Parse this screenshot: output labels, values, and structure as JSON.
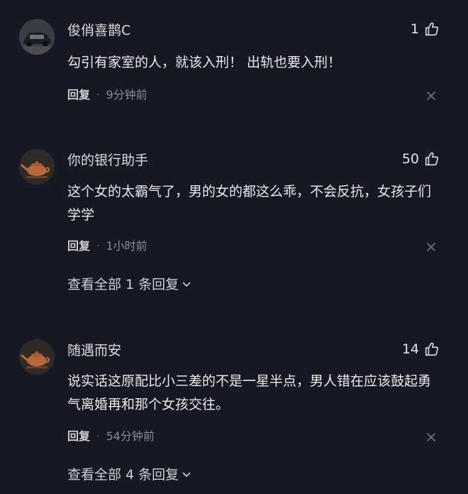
{
  "comments": [
    {
      "username": "俊俏喜鹊C",
      "likes": "1",
      "text": "勾引有家室的人，就该入刑！ 出轨也要入刑！",
      "reply_label": "回复",
      "separator": "·",
      "time": "9分钟前",
      "avatar_icon": "car-avatar"
    },
    {
      "username": "你的银行助手",
      "likes": "50",
      "text": "这个女的太霸气了，男的女的都这么乖，不会反抗，女孩子们学学",
      "reply_label": "回复",
      "separator": "·",
      "time": "1小时前",
      "view_all": "查看全部 1 条回复",
      "avatar_icon": "teapot-avatar"
    },
    {
      "username": "随遇而安",
      "likes": "14",
      "text": "说实话这原配比小三差的不是一星半点，男人错在应该鼓起勇气离婚再和那个女孩交往。",
      "reply_label": "回复",
      "separator": "·",
      "time": "54分钟前",
      "view_all": "查看全部 4 条回复",
      "avatar_icon": "teapot-avatar"
    }
  ],
  "colors": {
    "background": "#161823",
    "text": "#eaeaec",
    "muted": "#8a8b93"
  }
}
